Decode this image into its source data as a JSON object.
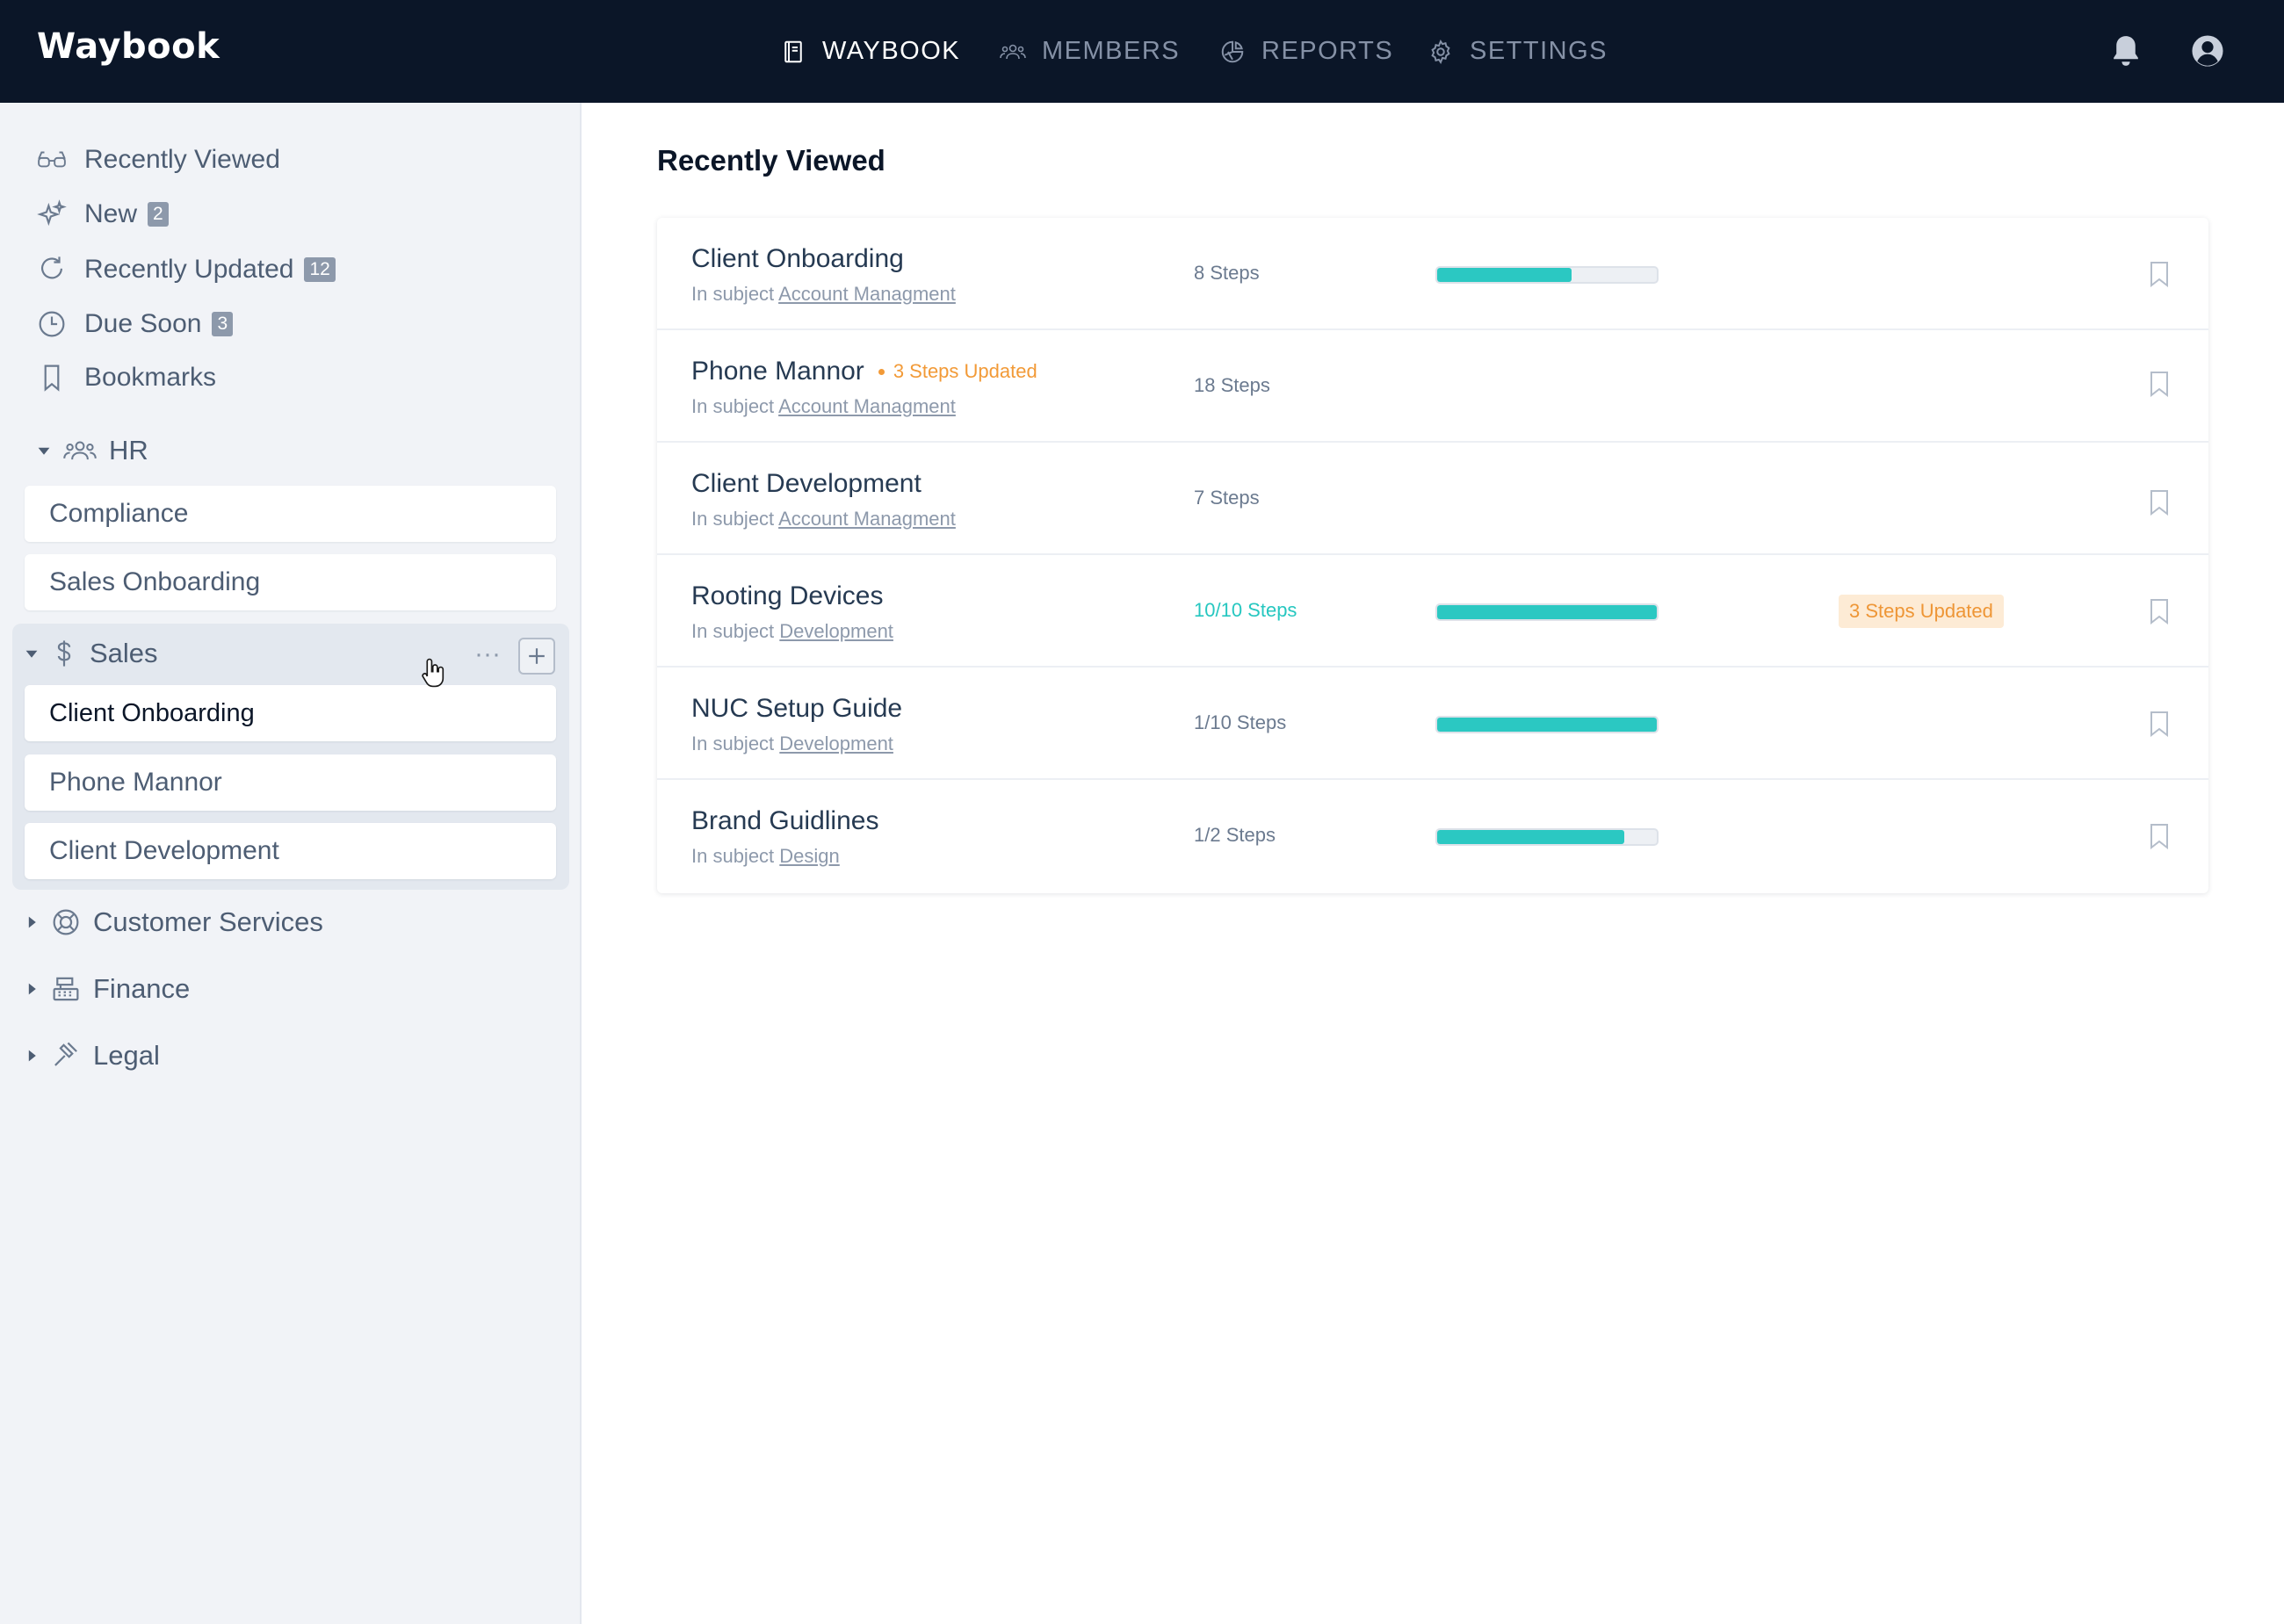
{
  "app": {
    "logo": "Waybook"
  },
  "nav": [
    {
      "label": "WAYBOOK",
      "icon": "book-icon",
      "active": true
    },
    {
      "label": "MEMBERS",
      "icon": "users-icon"
    },
    {
      "label": "REPORTS",
      "icon": "pie-chart-icon"
    },
    {
      "label": "SETTINGS",
      "icon": "gear-icon"
    }
  ],
  "header_icons": [
    "bell-icon",
    "user-avatar-icon"
  ],
  "sidebar": {
    "quick_links": [
      {
        "label": "Recently Viewed",
        "icon": "glasses-icon"
      },
      {
        "label": "New",
        "icon": "sparkles-icon",
        "badge": "2"
      },
      {
        "label": "Recently Updated",
        "icon": "refresh-icon",
        "badge": "12"
      },
      {
        "label": "Due Soon",
        "icon": "clock-icon",
        "badge": "3"
      },
      {
        "label": "Bookmarks",
        "icon": "bookmark-icon"
      }
    ],
    "groups": {
      "hr": {
        "label": "HR",
        "icon": "users-icon",
        "expanded": true,
        "items": [
          "Compliance",
          "Sales Onboarding"
        ]
      },
      "sales": {
        "label": "Sales",
        "icon": "dollar-icon",
        "expanded": true,
        "more": "···",
        "items": [
          "Client Onboarding",
          "Phone Mannor",
          "Client Development"
        ],
        "active_item": "Client Onboarding"
      },
      "customer_services": {
        "label": "Customer Services",
        "icon": "lifebuoy-icon",
        "expanded": false
      },
      "finance": {
        "label": "Finance",
        "icon": "cash-register-icon",
        "expanded": false
      },
      "legal": {
        "label": "Legal",
        "icon": "gavel-icon",
        "expanded": false
      }
    }
  },
  "main": {
    "title": "Recently Viewed",
    "subject_prefix": "In subject",
    "rows": [
      {
        "title": "Client Onboarding",
        "subject": "Account Managment",
        "steps": "8 Steps",
        "progress": 0.61
      },
      {
        "title": "Phone Mannor",
        "updated": "3 Steps Updated",
        "subject": "Account Managment",
        "steps": "18 Steps"
      },
      {
        "title": "Client Development",
        "subject": "Account Managment",
        "steps": "7 Steps"
      },
      {
        "title": "Rooting Devices",
        "subject": "Development",
        "steps": "10/10 Steps",
        "progress": 1.0,
        "badge": "3 Steps Updated"
      },
      {
        "title": "NUC Setup Guide",
        "subject": "Development",
        "steps": "1/10 Steps",
        "progress": 1.0
      },
      {
        "title": "Brand Guidlines",
        "subject": "Design",
        "steps": "1/2 Steps",
        "progress": 0.85
      }
    ]
  },
  "colors": {
    "nav_bg": "#0b1628",
    "accent": "#2bc8c2",
    "warning": "#f29a37",
    "sidebar_bg": "#f1f3f7"
  }
}
